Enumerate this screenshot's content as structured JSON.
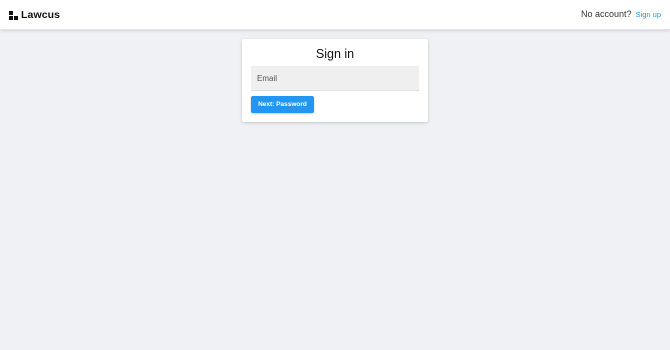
{
  "header": {
    "brand": "Lawcus",
    "no_account_text": "No account?",
    "signup_link": "Sign up"
  },
  "signin": {
    "title": "Sign in",
    "email_placeholder": "Email",
    "email_value": "",
    "next_button": "Next: Password"
  },
  "colors": {
    "accent": "#2196f3",
    "page_background": "#f0f1f4",
    "input_background": "#efefef"
  },
  "icons": {
    "brand_logo": "lawcus-logo-icon"
  }
}
